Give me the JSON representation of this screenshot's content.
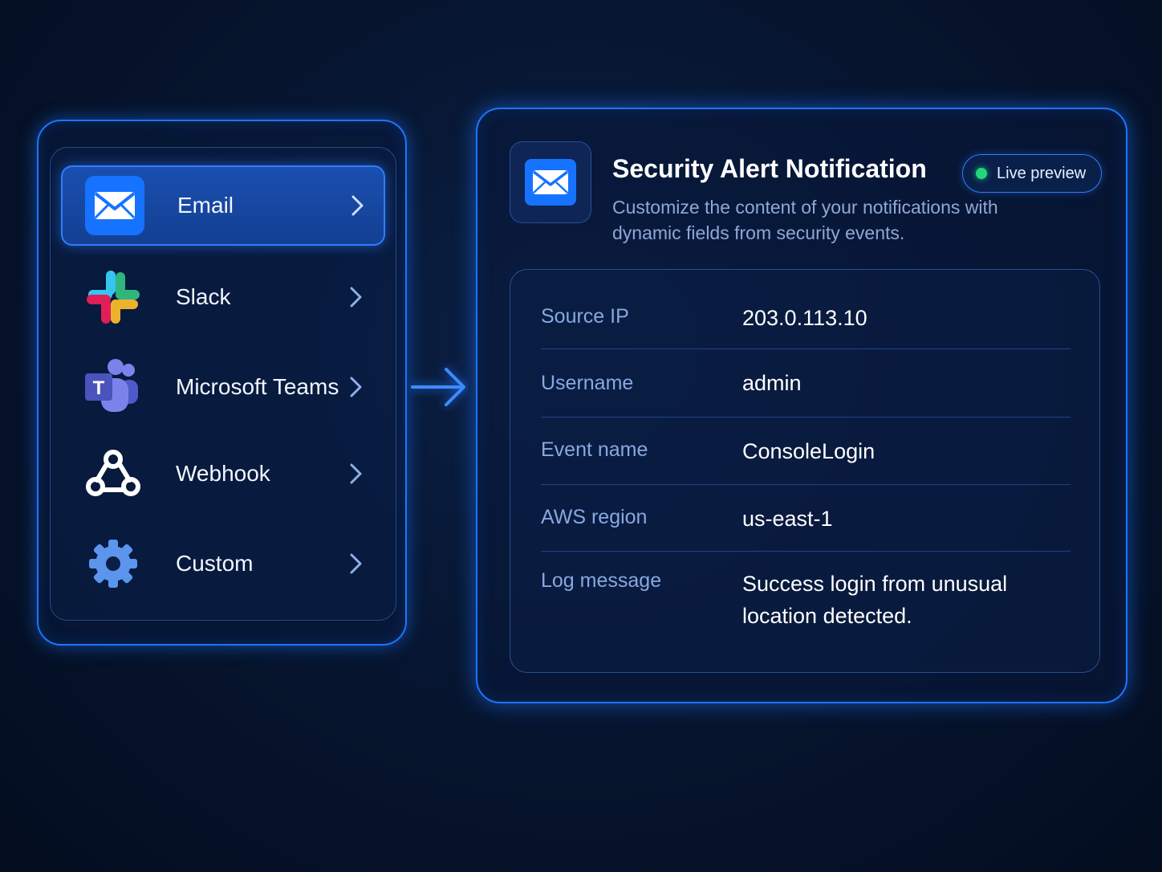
{
  "channels": {
    "items": [
      {
        "label": "Email",
        "icon": "email-icon",
        "active": true
      },
      {
        "label": "Slack",
        "icon": "slack-icon",
        "active": false
      },
      {
        "label": "Microsoft Teams",
        "icon": "teams-icon",
        "active": false
      },
      {
        "label": "Webhook",
        "icon": "webhook-icon",
        "active": false
      },
      {
        "label": "Custom",
        "icon": "gear-icon",
        "active": false
      }
    ]
  },
  "preview": {
    "icon": "email-icon",
    "title": "Security Alert Notification",
    "description": "Customize the content of your notifications with dynamic fields from security events.",
    "badge": "Live preview",
    "fields": [
      {
        "label": "Source IP",
        "value": "203.0.113.10"
      },
      {
        "label": "Username",
        "value": "admin"
      },
      {
        "label": "Event name",
        "value": "ConsoleLogin"
      },
      {
        "label": "AWS region",
        "value": "us-east-1"
      },
      {
        "label": "Log message",
        "value": "Success login from unusual location detected."
      }
    ]
  },
  "colors": {
    "accent": "#1e74ff",
    "background": "#071631",
    "live": "#22d67a",
    "label": "#88a8e0"
  }
}
